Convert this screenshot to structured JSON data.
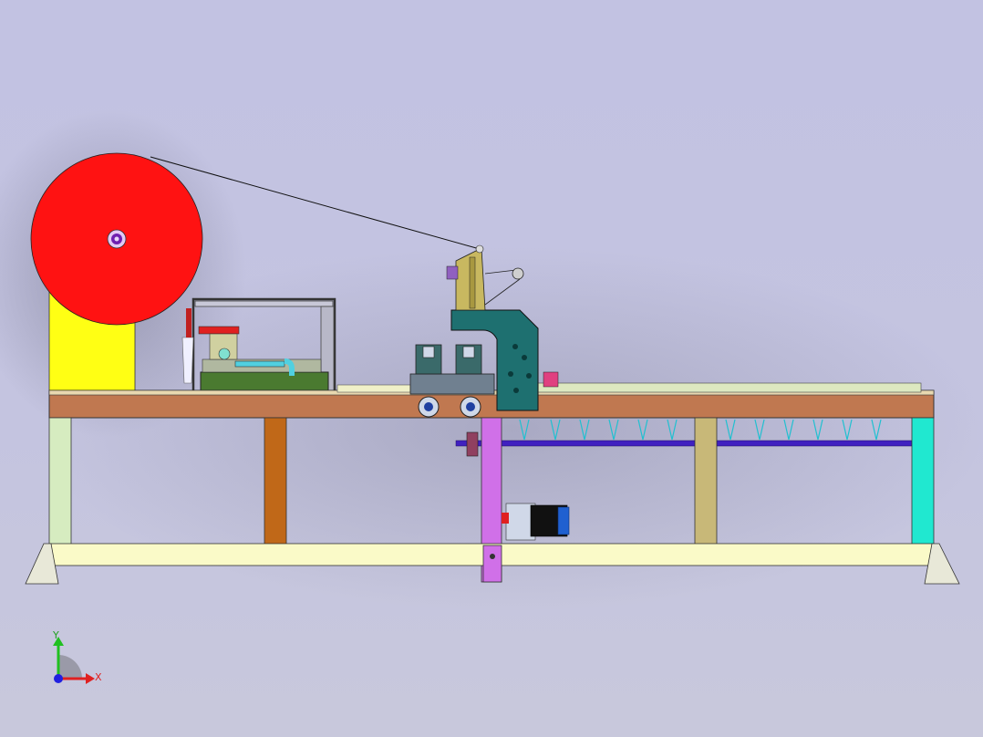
{
  "viewport": {
    "background": "#c3c3e1"
  },
  "triad": {
    "x_label": "X",
    "y_label": "Y",
    "x_color": "#e02020",
    "y_color": "#20c020",
    "z_color": "#2020e0"
  },
  "colors": {
    "reel": "#ff1212",
    "reel_stand": "#ffff14",
    "table_top": "#c07850",
    "frame_leg_left": "#d6ecc0",
    "frame_leg_center": "#d070e8",
    "frame_leg_right": "#20e8d0",
    "frame_beam": "#fafac8",
    "press_body": "#1e7070",
    "motor": "#2060d0",
    "rod": "#4020c0"
  }
}
